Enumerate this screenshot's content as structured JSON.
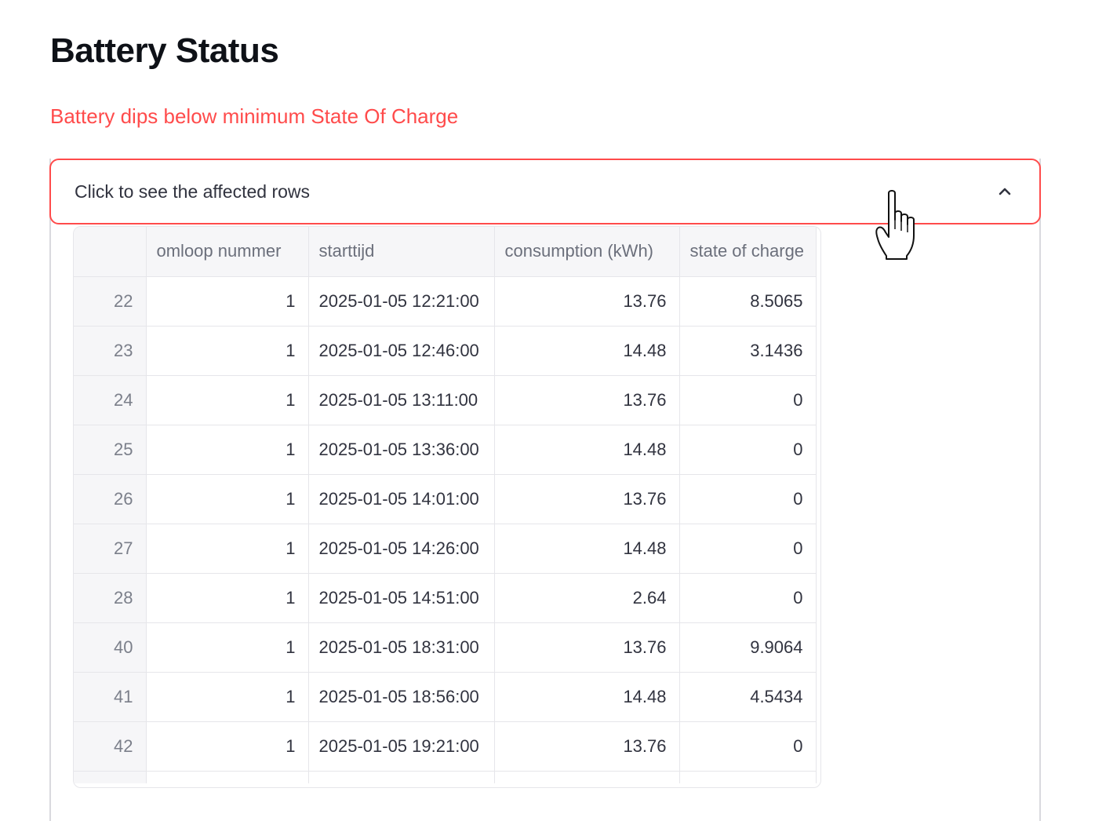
{
  "page": {
    "title": "Battery Status",
    "warning": "Battery dips below minimum State Of Charge"
  },
  "expander": {
    "label": "Click to see the affected rows",
    "icon": "chevron-up-icon",
    "expanded": true
  },
  "table": {
    "columns": [
      "",
      "omloop nummer",
      "starttijd",
      "consumption (kWh)",
      "state of charge"
    ],
    "rows": [
      {
        "index": "22",
        "omloop": "1",
        "start": "2025-01-05 12:21:00",
        "consumption": "13.76",
        "soc": "8.5065"
      },
      {
        "index": "23",
        "omloop": "1",
        "start": "2025-01-05 12:46:00",
        "consumption": "14.48",
        "soc": "3.1436"
      },
      {
        "index": "24",
        "omloop": "1",
        "start": "2025-01-05 13:11:00",
        "consumption": "13.76",
        "soc": "0"
      },
      {
        "index": "25",
        "omloop": "1",
        "start": "2025-01-05 13:36:00",
        "consumption": "14.48",
        "soc": "0"
      },
      {
        "index": "26",
        "omloop": "1",
        "start": "2025-01-05 14:01:00",
        "consumption": "13.76",
        "soc": "0"
      },
      {
        "index": "27",
        "omloop": "1",
        "start": "2025-01-05 14:26:00",
        "consumption": "14.48",
        "soc": "0"
      },
      {
        "index": "28",
        "omloop": "1",
        "start": "2025-01-05 14:51:00",
        "consumption": "2.64",
        "soc": "0"
      },
      {
        "index": "40",
        "omloop": "1",
        "start": "2025-01-05 18:31:00",
        "consumption": "13.76",
        "soc": "9.9064"
      },
      {
        "index": "41",
        "omloop": "1",
        "start": "2025-01-05 18:56:00",
        "consumption": "14.48",
        "soc": "4.5434"
      },
      {
        "index": "42",
        "omloop": "1",
        "start": "2025-01-05 19:21:00",
        "consumption": "13.76",
        "soc": "0"
      }
    ]
  },
  "colors": {
    "warning": "#ff4b4b",
    "expander_border": "#ff4b4b",
    "header_bg": "#f6f6f8"
  },
  "cursor": {
    "icon": "hand-cursor-icon"
  }
}
